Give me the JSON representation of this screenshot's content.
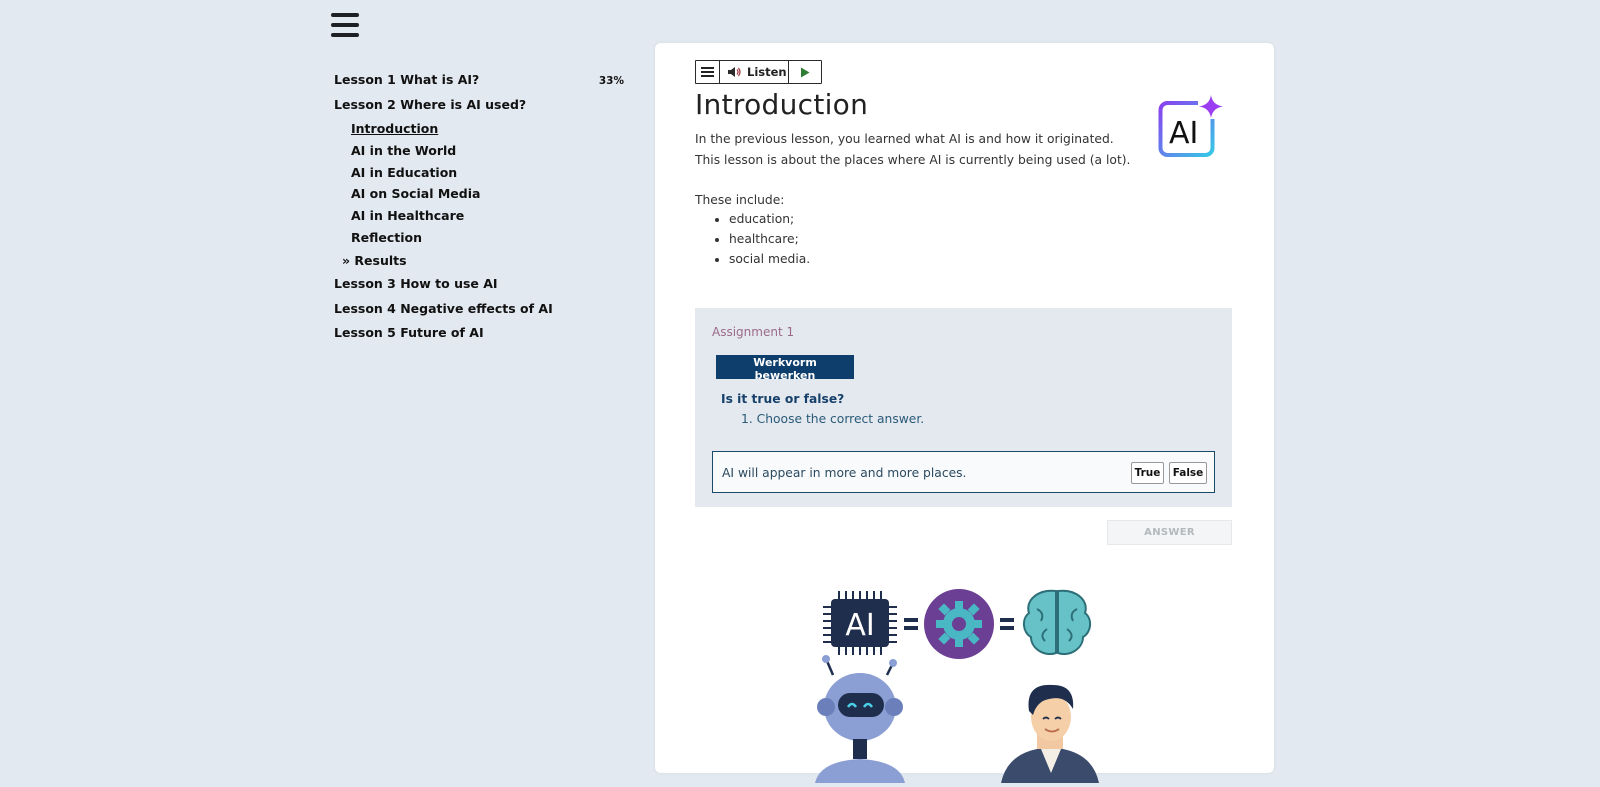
{
  "sidebar": {
    "lessons": [
      {
        "label": "Lesson 1 What is AI?",
        "progress": "33%"
      },
      {
        "label": "Lesson 2 Where is AI used?"
      },
      {
        "label": "Lesson 3 How to use AI"
      },
      {
        "label": "Lesson 4 Negative effects of AI"
      },
      {
        "label": "Lesson 5 Future of AI"
      }
    ],
    "subitems": [
      "Introduction",
      "AI in the World",
      "AI in Education",
      "AI on Social Media",
      "AI in Healthcare",
      "Reflection",
      "» Results"
    ],
    "current_subitem": "Introduction"
  },
  "toolbar": {
    "listen_label": "Listen",
    "icons": [
      "menu-icon",
      "speaker-icon",
      "play-icon"
    ]
  },
  "page": {
    "title": "Introduction",
    "intro": "In the previous lesson, you learned what AI is and how it originated. This lesson is about the places where AI is currently being used (a lot).",
    "includes_label": "These include:",
    "bullets": [
      "education;",
      "healthcare;",
      "social media."
    ],
    "logo_text": "AI"
  },
  "assignment": {
    "label": "Assignment 1",
    "edit_button": "Werkvorm bewerken",
    "question_title": "Is it true or false?",
    "instruction": "1. Choose the correct answer.",
    "statement": "AI will appear in more and more places.",
    "true_label": "True",
    "false_label": "False",
    "answer_button": "ANSWER"
  },
  "illustration": {
    "chip_text": "AI"
  },
  "colors": {
    "background": "#e3e9f0",
    "edit_button": "#0e3e6b",
    "assignment_bg": "#e4e9ef",
    "assignment_label": "#9a6a8a",
    "question": "#16406a",
    "play_green": "#2e7d32"
  }
}
